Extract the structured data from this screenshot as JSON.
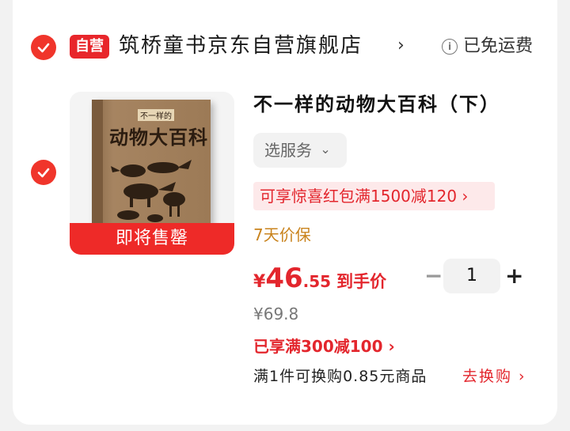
{
  "shop": {
    "badge": "自营",
    "name": "筑桥童书京东自营旗舰店",
    "chevron": "›",
    "shipping": "已免运费",
    "info_icon": "i"
  },
  "product": {
    "title": "不一样的动物大百科（下）",
    "cover": {
      "small_text": "不一样的",
      "title_text": "动物大百科"
    },
    "stock_banner": "即将售罄",
    "service_label": "选服务",
    "service_chevron": "⌄",
    "coupon": "可享惊喜红包满1500减120 ›",
    "protection": "7天价保",
    "price": {
      "symbol": "¥",
      "integer": "46",
      "decimal": ".55",
      "tag": "到手价"
    },
    "original_price": "¥69.8",
    "promo": "已享满300减100 ›",
    "swap_info": "满1件可换购0.85元商品",
    "swap_link": "去换购 ›"
  },
  "quantity": {
    "minus": "−",
    "value": "1",
    "plus": "+"
  },
  "colors": {
    "accent": "#e3262d",
    "badge": "#e8262b",
    "protect": "#c9831d"
  },
  "icons": [
    "check-icon",
    "info-icon",
    "chevron-right-icon",
    "chevron-down-icon"
  ]
}
